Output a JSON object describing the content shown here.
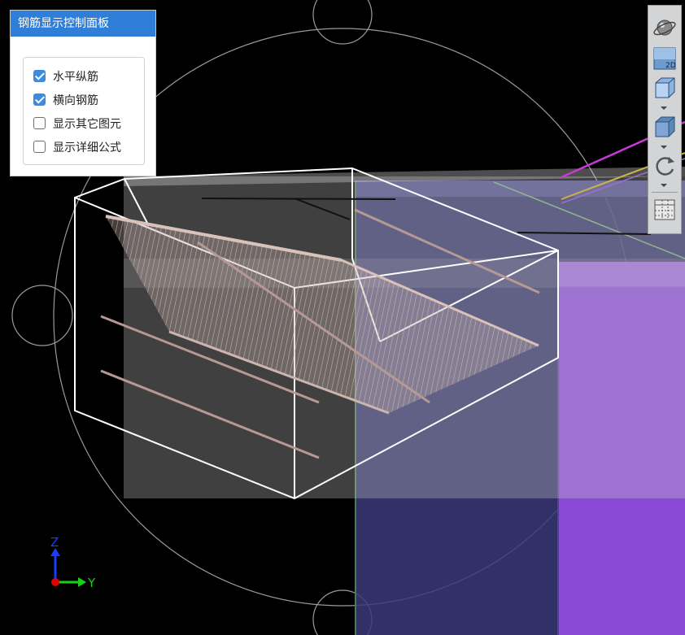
{
  "panel": {
    "title": "钢筋显示控制面板",
    "options": [
      {
        "label": "水平纵筋",
        "checked": true
      },
      {
        "label": "横向钢筋",
        "checked": true
      },
      {
        "label": "显示其它图元",
        "checked": false
      },
      {
        "label": "显示详细公式",
        "checked": false
      }
    ]
  },
  "toolbar": {
    "buttons": [
      {
        "icon": "orbit-icon"
      },
      {
        "icon": "view-2d-icon",
        "label": "2D"
      },
      {
        "icon": "view-3d-box-icon"
      },
      {
        "icon": "solid-box-icon"
      },
      {
        "icon": "rotate-icon"
      },
      {
        "icon": "grid-settings-icon"
      }
    ]
  },
  "axis": {
    "z_label": "Z",
    "y_label": "Y"
  },
  "colors": {
    "panel_header": "#2f7fd8",
    "checkbox": "#3b8be0",
    "purple_wall": "#7b3fcf",
    "rebar": "#c9b3ac",
    "axis_z": "#1a3cff",
    "axis_y": "#18d018",
    "axis_origin": "#e00000"
  }
}
